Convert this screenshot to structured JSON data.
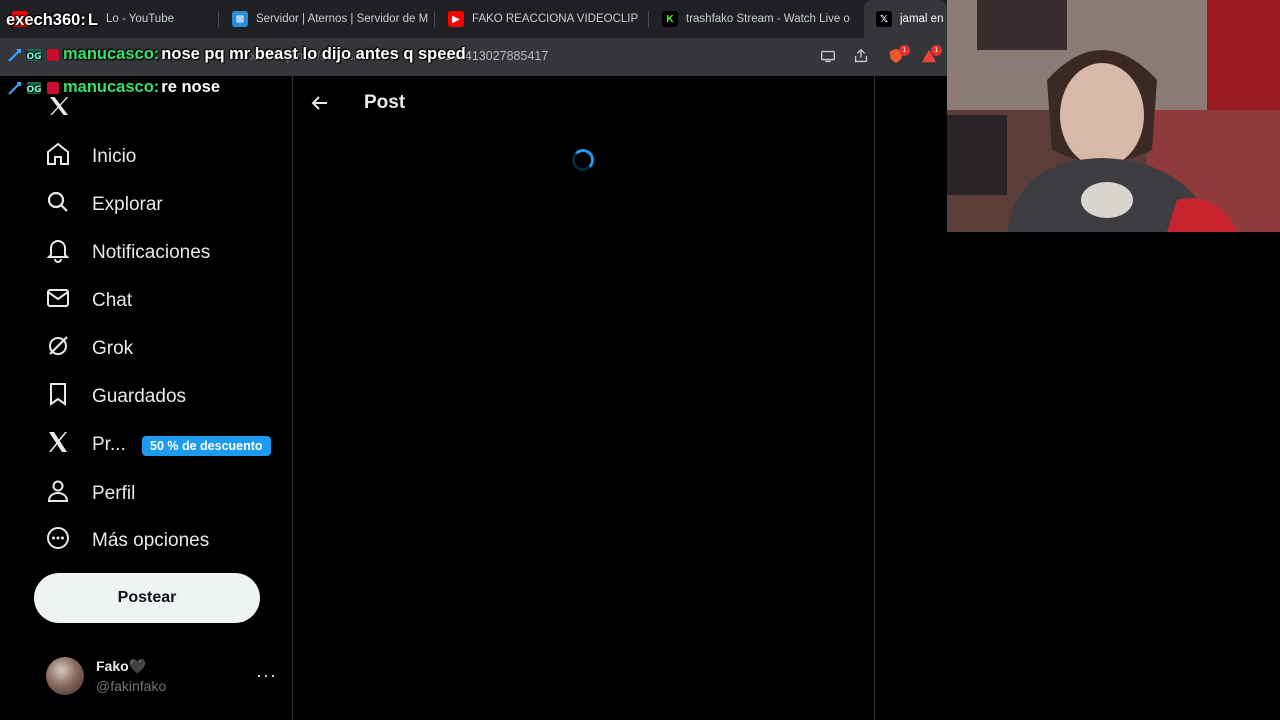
{
  "browser": {
    "tabs": [
      {
        "label": "Lo - YouTube",
        "icon": "youtube-icon",
        "color": "#ff0000"
      },
      {
        "label": "Servidor | Aternos | Servidor de M",
        "icon": "aternos-icon",
        "color": "#2a8cd6"
      },
      {
        "label": "FAKO REACCIONA VIDEOCLIP DE",
        "icon": "youtube-icon",
        "color": "#ff0000"
      },
      {
        "label": "trashfako Stream - Watch Live o",
        "icon": "kick-icon",
        "color": "#53fc18"
      },
      {
        "label": "jamal en X",
        "icon": "x-icon",
        "color": "#ffffff"
      }
    ],
    "url": "1146413027885417"
  },
  "chat": [
    {
      "user": "exech360:",
      "message": "L",
      "badges": []
    },
    {
      "user": "manucasco:",
      "message": "nose pq mr beast lo dijo antes q speed",
      "badges": [
        "sword-badge",
        "og-badge",
        "red-badge"
      ]
    },
    {
      "user": "manucasco:",
      "message": "re nose",
      "badges": [
        "sword-badge",
        "og-badge",
        "red-badge"
      ]
    }
  ],
  "sidebar": {
    "items": [
      {
        "label": "Inicio",
        "icon": "home-icon"
      },
      {
        "label": "Explorar",
        "icon": "search-icon"
      },
      {
        "label": "Notificaciones",
        "icon": "bell-icon"
      },
      {
        "label": "Chat",
        "icon": "mail-icon"
      },
      {
        "label": "Grok",
        "icon": "grok-icon"
      },
      {
        "label": "Guardados",
        "icon": "bookmark-icon"
      },
      {
        "label": "Pr...",
        "icon": "x-premium-icon",
        "badge": "50 % de descuento"
      },
      {
        "label": "Perfil",
        "icon": "person-icon"
      },
      {
        "label": "Más opciones",
        "icon": "more-circle-icon"
      }
    ],
    "post_button": "Postear",
    "account": {
      "name": "Fako🖤",
      "handle": "@fakinfako",
      "more": "···"
    }
  },
  "main": {
    "title": "Post"
  },
  "colors": {
    "accent": "#1d9bf0",
    "chat_user": "#35e06b",
    "border": "#2f3336"
  }
}
